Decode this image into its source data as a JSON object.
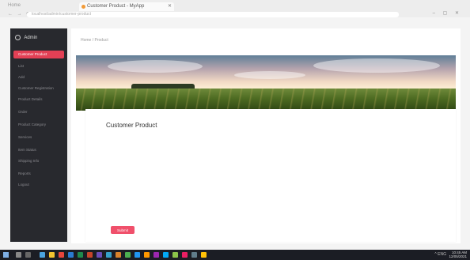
{
  "browser": {
    "home_tab": "Home",
    "tab_title": "Customer Product - MyApp",
    "address": "localhost/admin/customer-product",
    "nav_arrows": "← → ⟳",
    "window_controls": "– ▢ ✕"
  },
  "sidebar": {
    "brand": "Admin",
    "items": [
      {
        "label": "Customer Product",
        "active": true
      },
      {
        "label": "List"
      },
      {
        "label": "Add"
      },
      {
        "label": "Customer Registration"
      },
      {
        "label": "Product Details"
      },
      {
        "label": "Order"
      },
      {
        "label": "Product Category"
      },
      {
        "label": "Services"
      },
      {
        "label": "Item Status"
      },
      {
        "label": "Shipping Info"
      },
      {
        "label": "Reports"
      },
      {
        "label": "Logout"
      }
    ]
  },
  "content": {
    "breadcrumb": "Home / Product",
    "card_title": "Customer Product",
    "button_label": "Submit"
  },
  "taskbar": {
    "tray": "^ ENG",
    "time": "10:45 AM",
    "date": "12/05/2021"
  },
  "colors": {
    "sidebar_bg": "#28292e",
    "accent": "#e24055",
    "taskbar_bg": "#1b1d24"
  }
}
